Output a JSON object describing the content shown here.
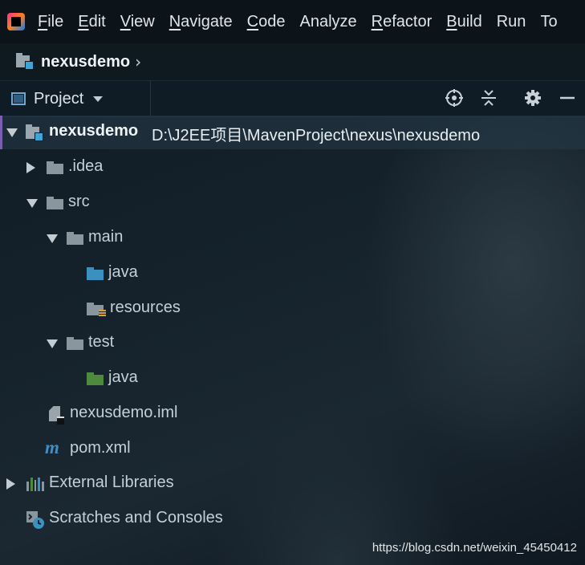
{
  "menubar": {
    "app_icon": "intellij-idea-icon",
    "items": [
      {
        "mnemonic": "F",
        "rest": "ile"
      },
      {
        "mnemonic": "E",
        "rest": "dit"
      },
      {
        "mnemonic": "V",
        "rest": "iew"
      },
      {
        "mnemonic": "N",
        "rest": "avigate"
      },
      {
        "mnemonic": "C",
        "rest": "ode"
      },
      {
        "mnemonic": "",
        "rest": "Analyze"
      },
      {
        "mnemonic": "R",
        "rest": "efactor"
      },
      {
        "mnemonic": "B",
        "rest": "uild"
      },
      {
        "mnemonic": "",
        "rest": "Run"
      },
      {
        "mnemonic": "",
        "rest": "To"
      }
    ]
  },
  "navbar": {
    "breadcrumb": "nexusdemo",
    "separator": "›"
  },
  "toolbar": {
    "view_label": "Project",
    "icons": [
      "locate-icon",
      "collapse-all-icon",
      "gear-icon",
      "hide-icon"
    ]
  },
  "tree": {
    "root_name": "nexusdemo",
    "root_path": "D:\\J2EE项目\\MavenProject\\nexus\\nexusdemo",
    "idea": ".idea",
    "src": "src",
    "main": "main",
    "main_java": "java",
    "resources": "resources",
    "test": "test",
    "test_java": "java",
    "iml": "nexusdemo.iml",
    "pom": "pom.xml",
    "external_libraries": "External Libraries",
    "scratches": "Scratches and Consoles"
  },
  "watermark": "https://blog.csdn.net/weixin_45450412"
}
